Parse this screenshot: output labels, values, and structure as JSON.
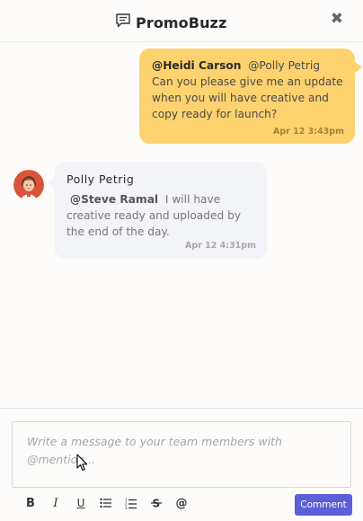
{
  "header": {
    "title": "PromoBuzz",
    "close_label": "✖"
  },
  "messages": [
    {
      "direction": "outgoing",
      "mention_1": "@Heidi Carson",
      "mention_2": "@Polly Petrig",
      "text": "Can you please give me an update when you will have creative and copy ready for launch?",
      "time": "Apr 12 3:43pm",
      "bubble_color": "#fdd26f"
    },
    {
      "direction": "incoming",
      "sender": "Polly Petrig",
      "mention": "@Steve Ramal",
      "text": "I will have creative ready and uploaded by the end of the day.",
      "time": "Apr 12 4:31pm",
      "bubble_color": "#f3f4f8"
    }
  ],
  "composer": {
    "placeholder": "Write a message to your team members with @mention..."
  },
  "toolbar": {
    "bold": "B",
    "italic": "I",
    "underline": "U",
    "strike": "S",
    "mention": "@",
    "comment_label": "Comment",
    "accent": "#5b5fd8"
  }
}
